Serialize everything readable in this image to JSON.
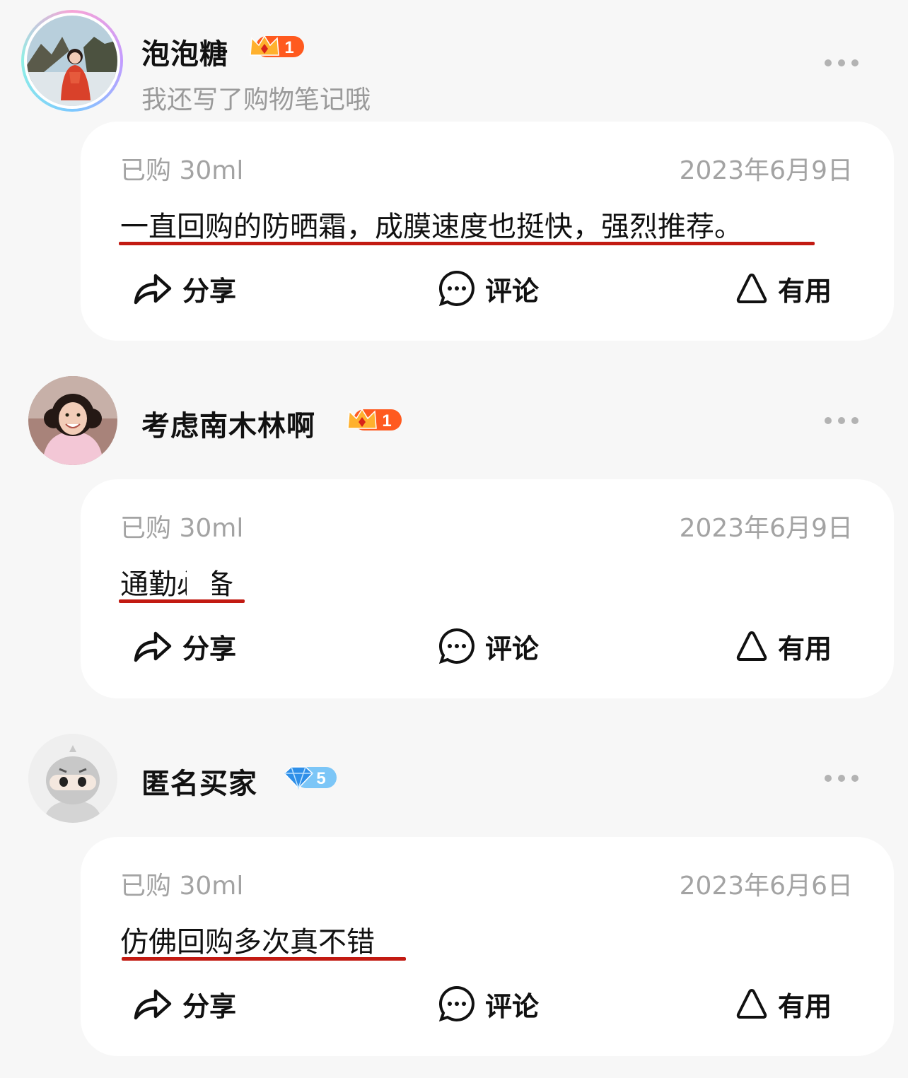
{
  "reviews": [
    {
      "username": "泡泡糖",
      "badge": {
        "type": "crown",
        "level": "1"
      },
      "subtitle": "我还写了购物笔记哦",
      "purchase": "已购 30ml",
      "date": "2023年6月9日",
      "content": "一直回购的防晒霜，成膜速度也挺快，强烈推荐。",
      "actions": {
        "share": "分享",
        "comment": "评论",
        "useful": "有用"
      }
    },
    {
      "username": "考虑南木林啊",
      "badge": {
        "type": "crown",
        "level": "1"
      },
      "purchase": "已购 30ml",
      "date": "2023年6月9日",
      "content": "通勤必备",
      "actions": {
        "share": "分享",
        "comment": "评论",
        "useful": "有用"
      }
    },
    {
      "username": "匿名买家",
      "badge": {
        "type": "diamond",
        "level": "5"
      },
      "purchase": "已购 30ml",
      "date": "2023年6月6日",
      "content": "仿佛回购多次真不错",
      "actions": {
        "share": "分享",
        "comment": "评论",
        "useful": "有用"
      }
    }
  ],
  "icons": {
    "more": "more-icon",
    "share": "share-arrow-icon",
    "comment": "comment-bubble-icon",
    "useful": "triangle-useful-icon"
  },
  "colors": {
    "background": "#f7f7f7",
    "card": "#ffffff",
    "underline": "#c21a12",
    "muted": "#a3a3a3",
    "crown_badge": "#ff5a1f",
    "diamond_badge": "#5fb8f5"
  }
}
